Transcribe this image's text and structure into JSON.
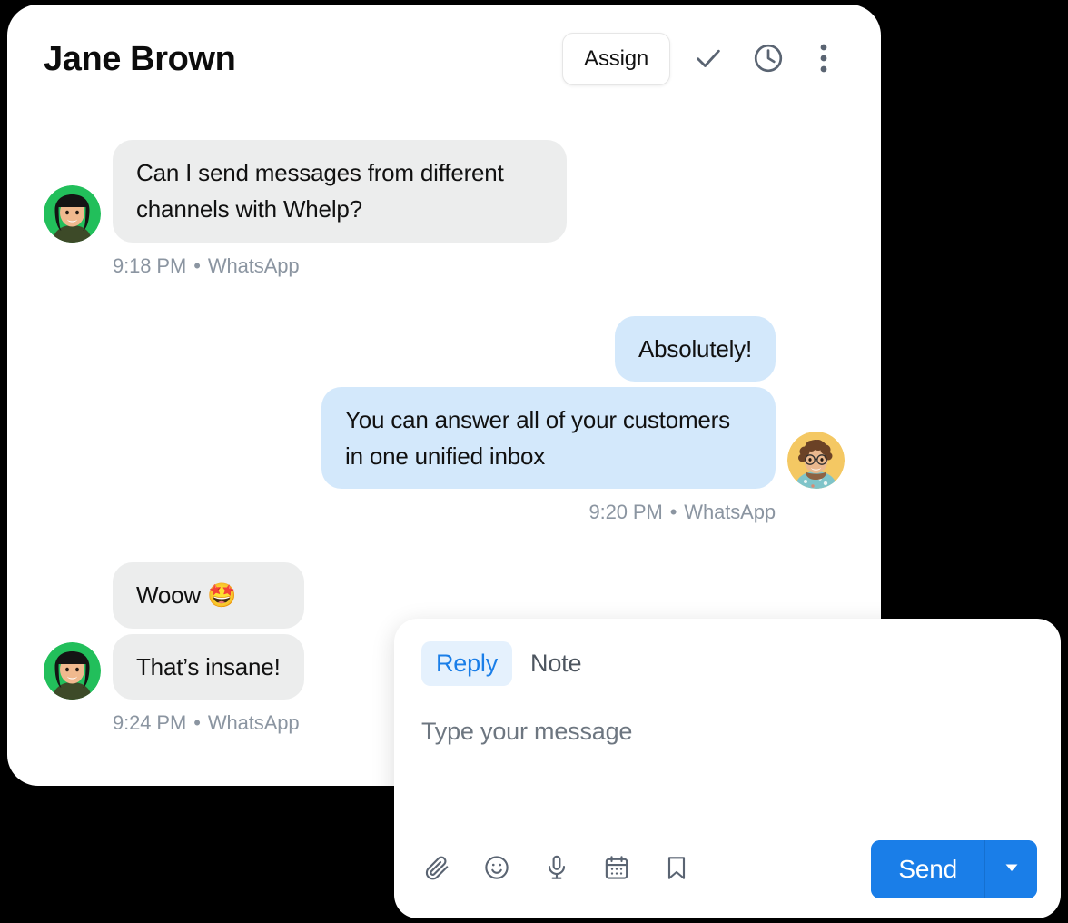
{
  "chat": {
    "header": {
      "contact_name": "Jane Brown",
      "assign_label": "Assign",
      "resolve_icon": "check-icon",
      "snooze_icon": "clock-icon",
      "more_icon": "kebab-menu-icon"
    },
    "messages": [
      {
        "direction": "in",
        "avatar_name": "jane-brown-avatar",
        "avatar_bg": "#22bf5b",
        "bubbles": [
          "Can I send messages from different channels with Whelp?"
        ],
        "time": "9:18 PM",
        "separator": "•",
        "channel": "WhatsApp"
      },
      {
        "direction": "out",
        "avatar_name": "agent-avatar",
        "avatar_bg": "#f4c863",
        "bubbles": [
          "Absolutely!",
          "You can answer all of your customers in one unified inbox"
        ],
        "time": "9:20 PM",
        "separator": "•",
        "channel": "WhatsApp"
      },
      {
        "direction": "in",
        "avatar_name": "jane-brown-avatar",
        "avatar_bg": "#22bf5b",
        "bubbles": [
          "Woow 🤩",
          "That’s insane!"
        ],
        "time": "9:24 PM",
        "separator": "•",
        "channel": "WhatsApp"
      }
    ]
  },
  "composer": {
    "tabs": [
      {
        "label": "Reply",
        "active": true
      },
      {
        "label": "Note",
        "active": false
      }
    ],
    "input": {
      "value": "",
      "placeholder": "Type your message"
    },
    "tools": [
      {
        "name": "attachment-icon",
        "title": "Attach file"
      },
      {
        "name": "emoji-icon",
        "title": "Insert emoji"
      },
      {
        "name": "microphone-icon",
        "title": "Record voice"
      },
      {
        "name": "calendar-icon",
        "title": "Schedule"
      },
      {
        "name": "bookmark-icon",
        "title": "Saved replies"
      }
    ],
    "send_label": "Send",
    "send_dropdown_icon": "chevron-down-icon"
  },
  "colors": {
    "accent": "#1a7ee8",
    "incoming_bubble": "#eceded",
    "outgoing_bubble": "#d3e8fb",
    "meta_text": "#8b95a1",
    "icon": "#5a6472",
    "page_background": "#000000",
    "card_background": "#ffffff"
  }
}
